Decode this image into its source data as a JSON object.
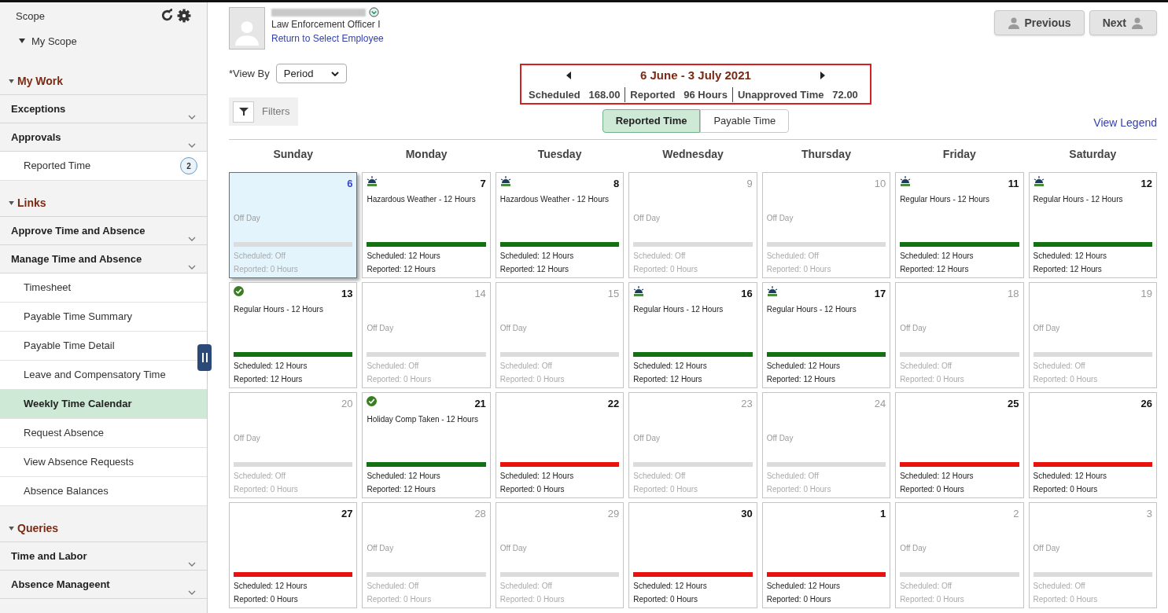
{
  "sidebar": {
    "scope_title": "Scope",
    "scope_item": "My Scope",
    "groups": [
      {
        "title": "My Work",
        "items": [
          {
            "kind": "header",
            "label": "Exceptions"
          },
          {
            "kind": "header",
            "label": "Approvals"
          },
          {
            "kind": "link",
            "label": "Reported Time",
            "badge": "2",
            "selected": false
          }
        ]
      },
      {
        "title": "Links",
        "items": [
          {
            "kind": "header",
            "label": "Approve Time and Absence"
          },
          {
            "kind": "header",
            "label": "Manage Time and Absence"
          },
          {
            "kind": "link",
            "label": "Timesheet",
            "selected": false
          },
          {
            "kind": "link",
            "label": "Payable Time Summary",
            "selected": false
          },
          {
            "kind": "link",
            "label": "Payable Time Detail",
            "selected": false
          },
          {
            "kind": "link",
            "label": "Leave and Compensatory Time",
            "selected": false
          },
          {
            "kind": "link",
            "label": "Weekly Time Calendar",
            "selected": true
          },
          {
            "kind": "link",
            "label": "Request Absence",
            "selected": false
          },
          {
            "kind": "link",
            "label": "View Absence Requests",
            "selected": false
          },
          {
            "kind": "link",
            "label": "Absence Balances",
            "selected": false
          }
        ]
      },
      {
        "title": "Queries",
        "items": [
          {
            "kind": "header",
            "label": "Time and Labor"
          },
          {
            "kind": "header",
            "label": "Absence Manageent"
          }
        ]
      }
    ]
  },
  "employee": {
    "job_title": "Law Enforcement Officer I",
    "return_link": "Return to Select Employee"
  },
  "nav_buttons": [
    "Previous",
    "Next"
  ],
  "view_by": {
    "label": "*View By",
    "value": "Period"
  },
  "filters": "Filters",
  "period": {
    "title": "6 June - 3 July 2021",
    "summary": [
      {
        "label": "Scheduled",
        "value": "168.00"
      },
      {
        "label": "Reported",
        "value": "96 Hours"
      },
      {
        "label": "Unapproved Time",
        "value": "72.00"
      }
    ]
  },
  "toggle": [
    {
      "label": "Reported Time",
      "selected": true
    },
    {
      "label": "Payable Time",
      "selected": false
    }
  ],
  "legend_link": "View Legend",
  "weekdays": [
    "Sunday",
    "Monday",
    "Tuesday",
    "Wednesday",
    "Thursday",
    "Friday",
    "Saturday"
  ],
  "days": [
    {
      "day": "6",
      "selected": true,
      "kind": "off",
      "entry": "Off Day",
      "scheduled": "Scheduled: Off",
      "reported": "Reported: 0 Hours"
    },
    {
      "day": "7",
      "selected": false,
      "kind": "pending",
      "entry": "Hazardous Weather - 12 Hours",
      "scheduled": "Scheduled: 12 Hours",
      "reported": "Reported: 12 Hours"
    },
    {
      "day": "8",
      "selected": false,
      "kind": "pending",
      "entry": "Hazardous Weather - 12 Hours",
      "scheduled": "Scheduled: 12 Hours",
      "reported": "Reported: 12 Hours"
    },
    {
      "day": "9",
      "selected": false,
      "kind": "off",
      "entry": "Off Day",
      "scheduled": "Scheduled: Off",
      "reported": "Reported: 0 Hours"
    },
    {
      "day": "10",
      "selected": false,
      "kind": "off",
      "entry": "Off Day",
      "scheduled": "Scheduled: Off",
      "reported": "Reported: 0 Hours"
    },
    {
      "day": "11",
      "selected": false,
      "kind": "pending",
      "entry": "Regular Hours - 12 Hours",
      "scheduled": "Scheduled: 12 Hours",
      "reported": "Reported: 12 Hours"
    },
    {
      "day": "12",
      "selected": false,
      "kind": "pending",
      "entry": "Regular Hours - 12 Hours",
      "scheduled": "Scheduled: 12 Hours",
      "reported": "Reported: 12 Hours"
    },
    {
      "day": "13",
      "selected": false,
      "kind": "approved",
      "entry": "Regular Hours - 12 Hours",
      "scheduled": "Scheduled: 12 Hours",
      "reported": "Reported: 12 Hours"
    },
    {
      "day": "14",
      "selected": false,
      "kind": "off",
      "entry": "Off Day",
      "scheduled": "Scheduled: Off",
      "reported": "Reported: 0 Hours"
    },
    {
      "day": "15",
      "selected": false,
      "kind": "off",
      "entry": "Off Day",
      "scheduled": "Scheduled: Off",
      "reported": "Reported: 0 Hours"
    },
    {
      "day": "16",
      "selected": false,
      "kind": "pending",
      "entry": "Regular Hours - 12 Hours",
      "scheduled": "Scheduled: 12 Hours",
      "reported": "Reported: 12 Hours"
    },
    {
      "day": "17",
      "selected": false,
      "kind": "pending",
      "entry": "Regular Hours - 12 Hours",
      "scheduled": "Scheduled: 12 Hours",
      "reported": "Reported: 12 Hours"
    },
    {
      "day": "18",
      "selected": false,
      "kind": "off",
      "entry": "Off Day",
      "scheduled": "Scheduled: Off",
      "reported": "Reported: 0 Hours"
    },
    {
      "day": "19",
      "selected": false,
      "kind": "off",
      "entry": "Off Day",
      "scheduled": "Scheduled: Off",
      "reported": "Reported: 0 Hours"
    },
    {
      "day": "20",
      "selected": false,
      "kind": "off",
      "entry": "Off Day",
      "scheduled": "Scheduled: Off",
      "reported": "Reported: 0 Hours"
    },
    {
      "day": "21",
      "selected": false,
      "kind": "approved",
      "entry": "Holiday Comp Taken - 12 Hours",
      "scheduled": "Scheduled: 12 Hours",
      "reported": "Reported: 12 Hours"
    },
    {
      "day": "22",
      "selected": false,
      "kind": "missing",
      "scheduled": "Scheduled: 12 Hours",
      "reported": "Reported: 0 Hours"
    },
    {
      "day": "23",
      "selected": false,
      "kind": "off",
      "entry": "Off Day",
      "scheduled": "Scheduled: Off",
      "reported": "Reported: 0 Hours"
    },
    {
      "day": "24",
      "selected": false,
      "kind": "off",
      "entry": "Off Day",
      "scheduled": "Scheduled: Off",
      "reported": "Reported: 0 Hours"
    },
    {
      "day": "25",
      "selected": false,
      "kind": "missing",
      "scheduled": "Scheduled: 12 Hours",
      "reported": "Reported: 0 Hours"
    },
    {
      "day": "26",
      "selected": false,
      "kind": "missing",
      "scheduled": "Scheduled: 12 Hours",
      "reported": "Reported: 0 Hours"
    },
    {
      "day": "27",
      "selected": false,
      "kind": "missing",
      "scheduled": "Scheduled: 12 Hours",
      "reported": "Reported: 0 Hours"
    },
    {
      "day": "28",
      "selected": false,
      "kind": "off",
      "entry": "Off Day",
      "scheduled": "Scheduled: Off",
      "reported": "Reported: 0 Hours"
    },
    {
      "day": "29",
      "selected": false,
      "kind": "off",
      "entry": "Off Day",
      "scheduled": "Scheduled: Off",
      "reported": "Reported: 0 Hours"
    },
    {
      "day": "30",
      "selected": false,
      "kind": "missing",
      "scheduled": "Scheduled: 12 Hours",
      "reported": "Reported: 0 Hours"
    },
    {
      "day": "1",
      "selected": false,
      "kind": "missing",
      "scheduled": "Scheduled: 12 Hours",
      "reported": "Reported: 0 Hours"
    },
    {
      "day": "2",
      "selected": false,
      "kind": "off",
      "entry": "Off Day",
      "scheduled": "Scheduled: Off",
      "reported": "Reported: 0 Hours"
    },
    {
      "day": "3",
      "selected": false,
      "kind": "off",
      "entry": "Off Day",
      "scheduled": "Scheduled: Off",
      "reported": "Reported: 0 Hours"
    }
  ]
}
